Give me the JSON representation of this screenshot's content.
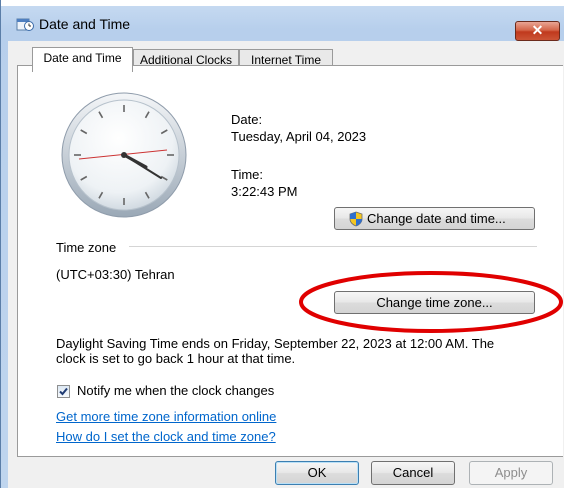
{
  "window": {
    "title": "Date and Time",
    "close_label": "✕"
  },
  "tabs": [
    {
      "label": "Date and Time",
      "active": true
    },
    {
      "label": "Additional Clocks",
      "active": false
    },
    {
      "label": "Internet Time",
      "active": false
    }
  ],
  "date": {
    "label": "Date:",
    "value": "Tuesday, April 04, 2023"
  },
  "time": {
    "label": "Time:",
    "value": "3:22:43 PM"
  },
  "change_date_button": "Change date and time...",
  "timezone": {
    "section_label": "Time zone",
    "value": "(UTC+03:30) Tehran",
    "change_button": "Change time zone..."
  },
  "dst_notice": {
    "line1": "Daylight Saving Time ends on Friday, September 22, 2023 at 12:00 AM. The",
    "line2": "clock is set to go back 1 hour at that time."
  },
  "notify_checkbox": {
    "label": "Notify me when the clock changes",
    "checked": true
  },
  "links": {
    "more_info": "Get more time zone information online",
    "how_to": "How do I set the clock and time zone?"
  },
  "footer": {
    "ok": "OK",
    "cancel": "Cancel",
    "apply": "Apply"
  },
  "colors": {
    "annotation": "#e00000",
    "link": "#0066cc",
    "close_button": "#c0391d"
  }
}
